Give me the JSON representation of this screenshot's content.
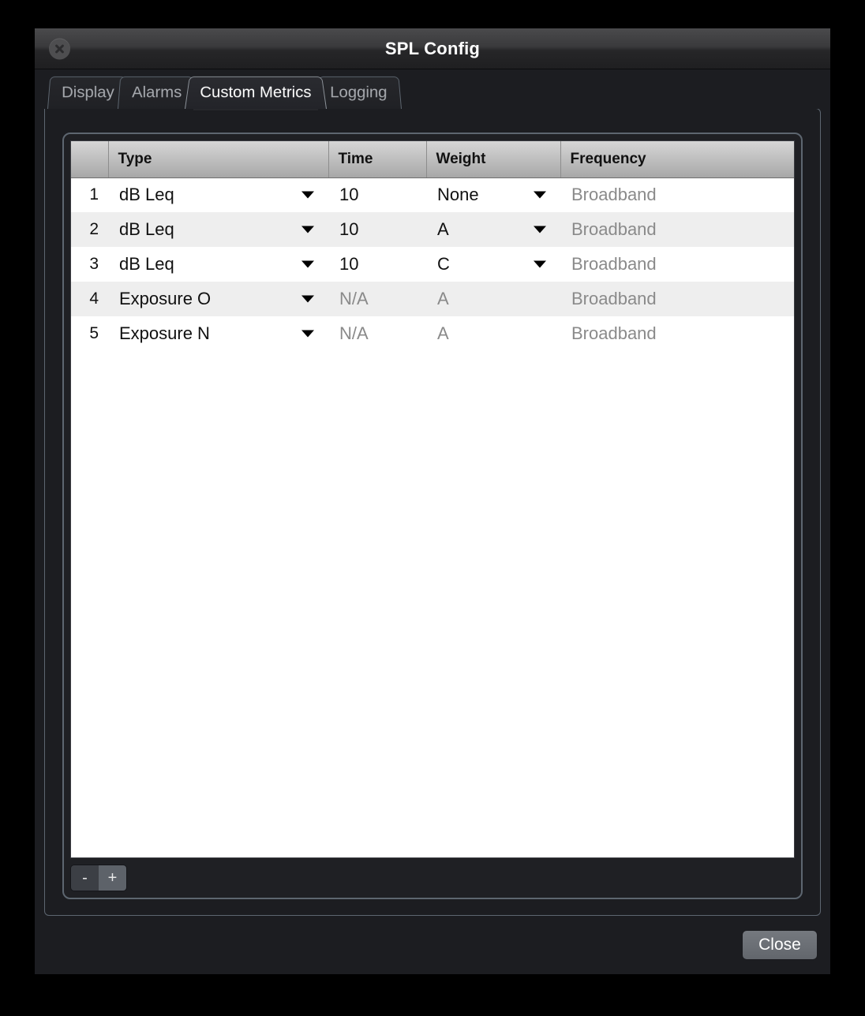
{
  "window": {
    "title": "SPL Config",
    "close_icon": "close-circle-icon"
  },
  "tabs": [
    {
      "label": "Display",
      "active": false
    },
    {
      "label": "Alarms",
      "active": false
    },
    {
      "label": "Custom Metrics",
      "active": true
    },
    {
      "label": "Logging",
      "active": false
    }
  ],
  "table": {
    "columns": [
      "",
      "Type",
      "Time",
      "Weight",
      "Frequency"
    ],
    "rows": [
      {
        "num": "1",
        "type": "dB Leq",
        "type_dropdown": true,
        "time": "10",
        "time_dim": false,
        "weight": "None",
        "weight_dropdown": true,
        "weight_dim": false,
        "frequency": "Broadband"
      },
      {
        "num": "2",
        "type": "dB Leq",
        "type_dropdown": true,
        "time": "10",
        "time_dim": false,
        "weight": "A",
        "weight_dropdown": true,
        "weight_dim": false,
        "frequency": "Broadband"
      },
      {
        "num": "3",
        "type": "dB Leq",
        "type_dropdown": true,
        "time": "10",
        "time_dim": false,
        "weight": "C",
        "weight_dropdown": true,
        "weight_dim": false,
        "frequency": "Broadband"
      },
      {
        "num": "4",
        "type": "Exposure O",
        "type_dropdown": true,
        "time": "N/A",
        "time_dim": true,
        "weight": "A",
        "weight_dropdown": false,
        "weight_dim": true,
        "frequency": "Broadband"
      },
      {
        "num": "5",
        "type": "Exposure N",
        "type_dropdown": true,
        "time": "N/A",
        "time_dim": true,
        "weight": "A",
        "weight_dropdown": false,
        "weight_dim": true,
        "frequency": "Broadband"
      }
    ]
  },
  "row_controls": {
    "remove_label": "-",
    "add_label": "+"
  },
  "footer": {
    "close_label": "Close"
  },
  "colors": {
    "window_bg": "#1c1d21",
    "titlebar_top": "#4a4a4c",
    "panel_border": "#5d6670",
    "tab_active_text": "#ffffff",
    "tab_inactive_text": "#a8abb0",
    "row_odd": "#ffffff",
    "row_even": "#eeeeee",
    "disabled_text": "#8a8a8a",
    "button_close_bg": "#75797f",
    "add_button_bg": "#5d6269"
  }
}
